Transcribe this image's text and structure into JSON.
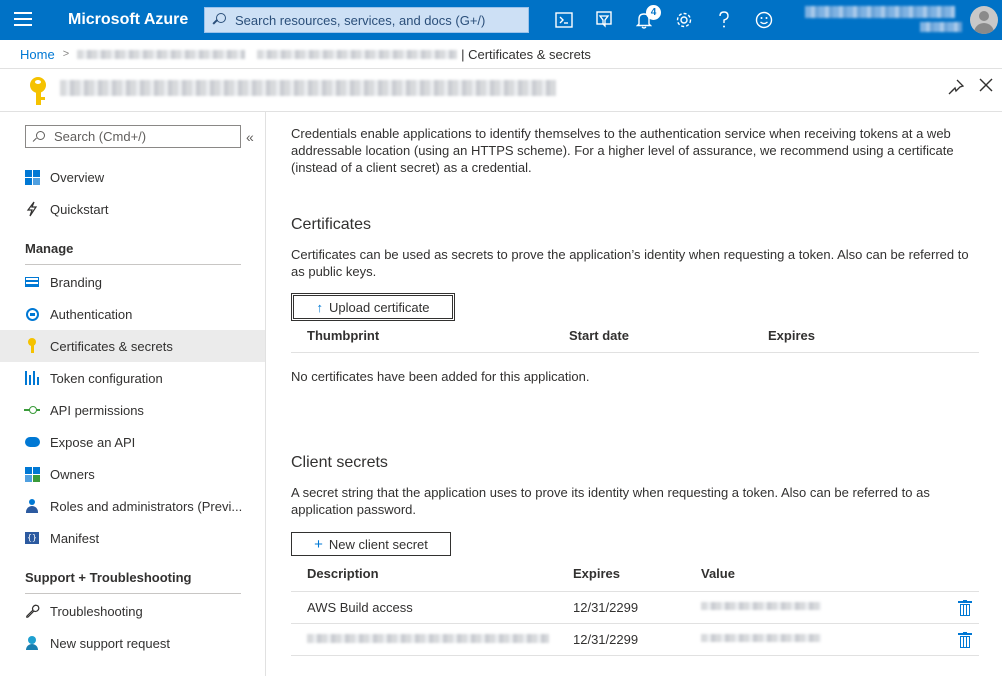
{
  "topbar": {
    "brand": "Microsoft Azure",
    "search_placeholder": "Search resources, services, and docs (G+/)",
    "notification_count": "4",
    "icons": [
      "cloud-shell-icon",
      "directory-filter-icon",
      "bell-icon",
      "gear-icon",
      "help-icon",
      "feedback-smiley-icon"
    ],
    "accent_color": "#0072c6"
  },
  "breadcrumb": {
    "home": "Home",
    "current": "| Certificates & secrets"
  },
  "sidebar": {
    "search_placeholder": "Search (Cmd+/)",
    "collapse_glyph": "«",
    "top_items": [
      {
        "label": "Overview",
        "icon": "overview-grid-icon"
      },
      {
        "label": "Quickstart",
        "icon": "quickstart-icon"
      }
    ],
    "manage_heading": "Manage",
    "manage_items": [
      {
        "label": "Branding",
        "icon": "branding-icon"
      },
      {
        "label": "Authentication",
        "icon": "authentication-icon"
      },
      {
        "label": "Certificates & secrets",
        "icon": "key-icon",
        "active": true
      },
      {
        "label": "Token configuration",
        "icon": "token-config-icon"
      },
      {
        "label": "API permissions",
        "icon": "api-permissions-icon"
      },
      {
        "label": "Expose an API",
        "icon": "expose-api-icon"
      },
      {
        "label": "Owners",
        "icon": "owners-icon"
      },
      {
        "label": "Roles and administrators (Previ...",
        "icon": "roles-icon"
      },
      {
        "label": "Manifest",
        "icon": "manifest-icon"
      }
    ],
    "support_heading": "Support + Troubleshooting",
    "support_items": [
      {
        "label": "Troubleshooting",
        "icon": "wrench-icon"
      },
      {
        "label": "New support request",
        "icon": "support-person-icon"
      }
    ]
  },
  "main": {
    "intro": "Credentials enable applications to identify themselves to the authentication service when receiving tokens at a web addressable location (using an HTTPS scheme). For a higher level of assurance, we recommend using a certificate (instead of a client secret) as a credential.",
    "certificates": {
      "heading": "Certificates",
      "description": "Certificates can be used as secrets to prove the application’s identity when requesting a token. Also can be referred to as public keys.",
      "upload_button": "Upload certificate",
      "columns": [
        "Thumbprint",
        "Start date",
        "Expires"
      ],
      "empty_message": "No certificates have been added for this application."
    },
    "client_secrets": {
      "heading": "Client secrets",
      "description": "A secret string that the application uses to prove its identity when requesting a token. Also can be referred to as application password.",
      "new_button": "New client secret",
      "columns": [
        "Description",
        "Expires",
        "Value"
      ],
      "rows": [
        {
          "description": "AWS Build access",
          "expires": "12/31/2299"
        },
        {
          "description": "",
          "expires": "12/31/2299"
        }
      ]
    }
  }
}
